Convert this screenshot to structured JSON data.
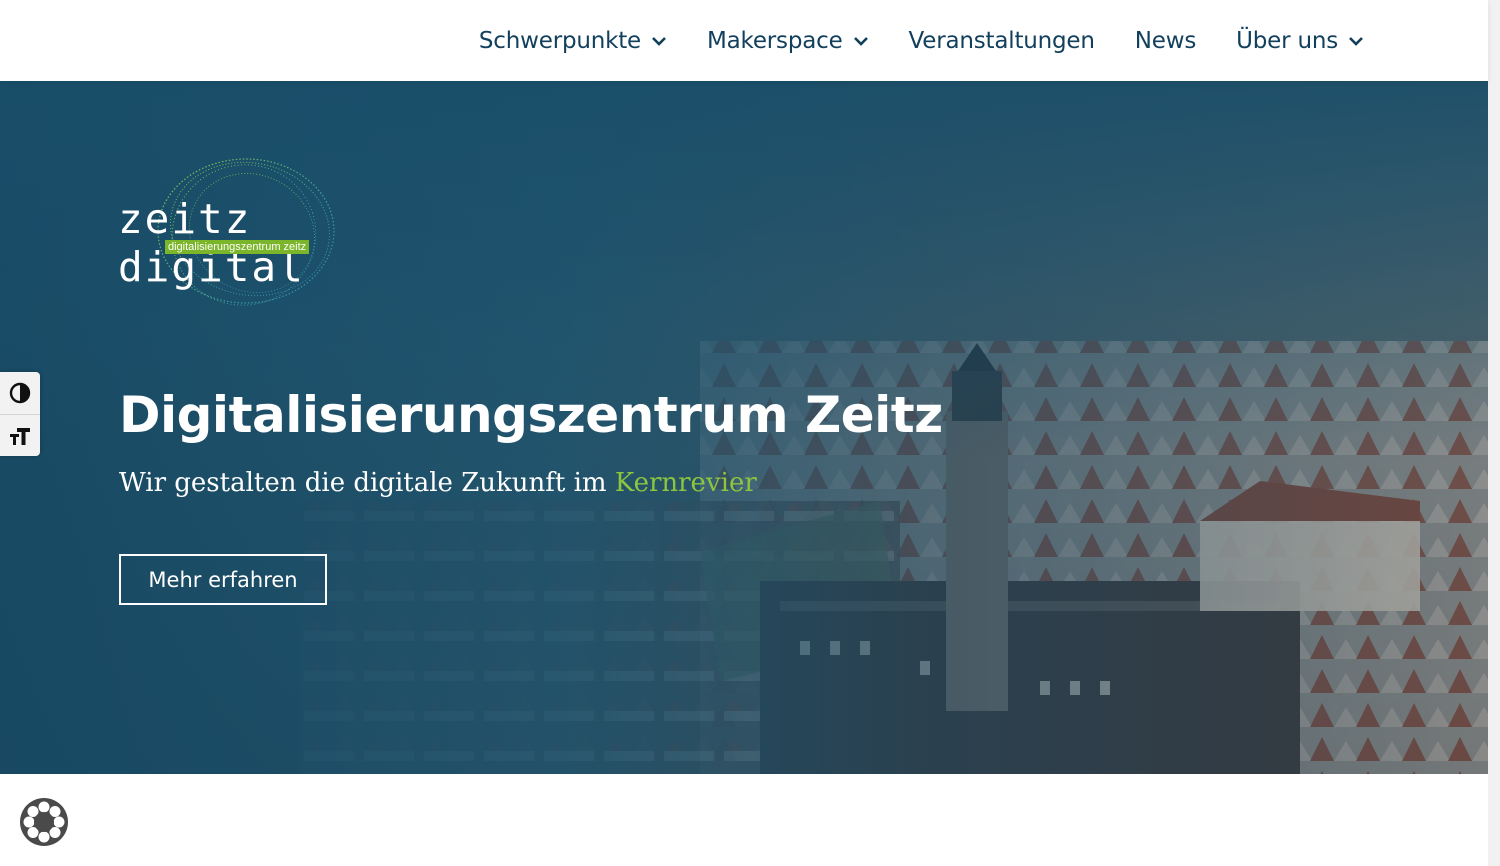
{
  "header": {
    "nav": [
      {
        "label": "Schwerpunkte",
        "has_dropdown": true
      },
      {
        "label": "Makerspace",
        "has_dropdown": true
      },
      {
        "label": "Veranstaltungen",
        "has_dropdown": false
      },
      {
        "label": "News",
        "has_dropdown": false
      },
      {
        "label": "Über uns",
        "has_dropdown": true
      }
    ]
  },
  "hero": {
    "logo": {
      "wordmark": "zeitz digital",
      "tagline": "digitalisierungszentrum zeitz"
    },
    "title": "Digitalisierungszentrum Zeitz",
    "subtitle_prefix": "Wir gestalten die digitale Zukunft im",
    "subtitle_accent": "Kernrevier",
    "cta_label": "Mehr erfahren"
  },
  "accessibility": {
    "contrast_icon": "contrast-icon",
    "font_size_icon": "font-size-icon"
  },
  "colors": {
    "nav_text": "#123f5c",
    "accent_green": "#8cc63f",
    "logo_tag_bg": "#7ab52a",
    "hero_overlay": "#164964"
  }
}
